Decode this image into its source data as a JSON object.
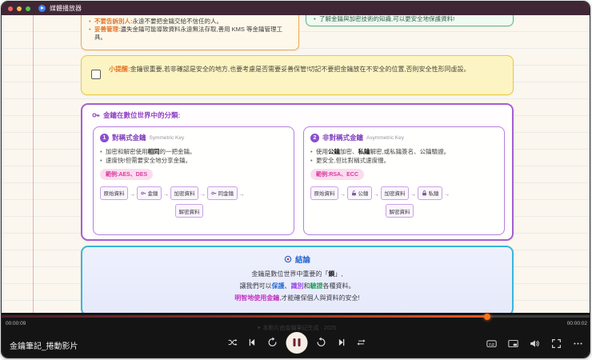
{
  "window": {
    "app_title": "媒體播放器"
  },
  "notes": {
    "warning": {
      "item1": [
        {
          "t": "不要告訴別人:",
          "c": "em-orange"
        },
        {
          "t": "永遠不要把金鑰交給不信任的人。"
        }
      ],
      "item2": [
        {
          "t": "妥善管理:",
          "c": "em-orange"
        },
        {
          "t": "遺失金鑰可能導致資料永遠無法存取,善用 KMS 等金鑰管理工具。"
        }
      ]
    },
    "tip": {
      "text": "了解金鑰與加密技術的知識,可以更安全地保護資料!"
    },
    "reminder": [
      {
        "t": "小提醒:",
        "c": "em-orange"
      },
      {
        "t": "金鑰很重要,若非確認是安全的地方,也要考慮是否需要妥善保管!切記不要把金鑰放在不安全的位置,否則安全性形同虛設。"
      }
    ],
    "classification": {
      "heading": "金鑰在數位世界中的分類:",
      "symmetric": {
        "num": "1",
        "title": "對稱式金鑰",
        "subtitle": "Symmetric Key",
        "bullet1": [
          {
            "t": "加密和解密使用"
          },
          {
            "t": "相同",
            "c": "em-strong"
          },
          {
            "t": "的一把金鑰。"
          }
        ],
        "bullet2": [
          {
            "t": "速度快!但需要安全地分享金鑰。"
          }
        ],
        "badge": "範例:AES、DES",
        "flow": {
          "a": "原始資料",
          "b": "金鑰",
          "c": "加密資料",
          "d": "同金鑰",
          "e": "解密資料"
        }
      },
      "asymmetric": {
        "num": "2",
        "title": "非對稱式金鑰",
        "subtitle": "Asymmetric Key",
        "bullet1": [
          {
            "t": "使用"
          },
          {
            "t": "公鑰",
            "c": "em-strong"
          },
          {
            "t": "加密、"
          },
          {
            "t": "私鑰",
            "c": "em-strong"
          },
          {
            "t": "解密,或私鑰簽名、公鑰驗證。"
          }
        ],
        "bullet2": [
          {
            "t": "更安全,但比對稱式速度慢。"
          }
        ],
        "badge": "範例:RSA、ECC",
        "flow": {
          "a": "原始資料",
          "b": "公鑰",
          "c": "加密資料",
          "d": "私鑰",
          "e": "解密資料"
        }
      }
    },
    "conclusion": {
      "title": "結論",
      "line1": [
        {
          "t": "金鑰是數位世界中重要的「"
        },
        {
          "t": "鎖",
          "c": "em-strong"
        },
        {
          "t": "」,"
        }
      ],
      "line2": [
        {
          "t": "讓我們可以"
        },
        {
          "t": "保護",
          "c": "em-blue"
        },
        {
          "t": "、"
        },
        {
          "t": "識別",
          "c": "em-purple"
        },
        {
          "t": "和"
        },
        {
          "t": "驗證",
          "c": "em-green"
        },
        {
          "t": "各種資料。"
        }
      ],
      "line3": [
        {
          "t": "明智地使用金鑰",
          "c": "em-magenta"
        },
        {
          "t": ",才能確保個人與資料的安全!"
        }
      ]
    },
    "watermark": "✦ 本影片由金鑰筆記生成 · 2025"
  },
  "player": {
    "current_time": "00:00:09",
    "end_time": "00:00:02",
    "media_title": "金鑰筆記_捲動影片",
    "progress_fill": "82.3%",
    "knob_left": "82.3%",
    "accent_color": "#f97316"
  }
}
